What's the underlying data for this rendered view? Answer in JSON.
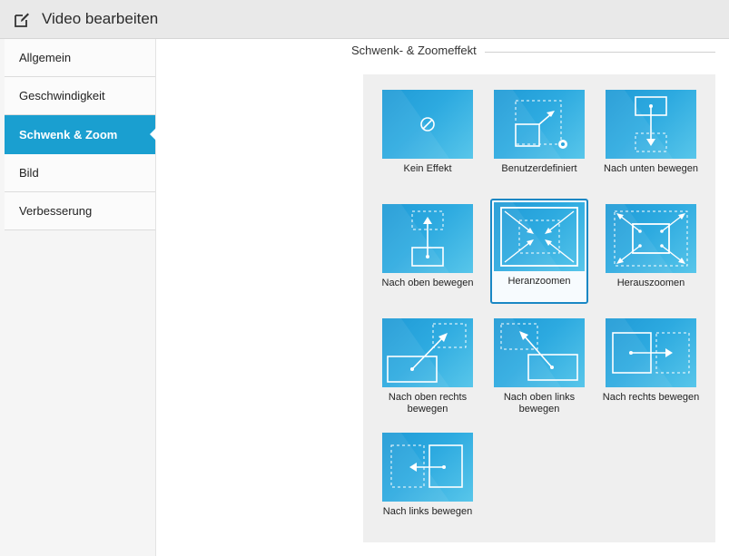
{
  "window": {
    "title": "Video bearbeiten",
    "icon": "edit-icon"
  },
  "sidebar": {
    "items": [
      {
        "label": "Allgemein",
        "active": false
      },
      {
        "label": "Geschwindigkeit",
        "active": false
      },
      {
        "label": "Schwenk & Zoom",
        "active": true
      },
      {
        "label": "Bild",
        "active": false
      },
      {
        "label": "Verbesserung",
        "active": false
      }
    ]
  },
  "section": {
    "title": "Schwenk- & Zoomeffekt"
  },
  "effects": [
    {
      "label": "Kein Effekt",
      "icon": "no-effect-icon",
      "selected": false
    },
    {
      "label": "Benutzerdefiniert",
      "icon": "custom-effect-icon",
      "selected": false
    },
    {
      "label": "Nach unten bewegen",
      "icon": "move-down-icon",
      "selected": false
    },
    {
      "label": "Nach oben bewegen",
      "icon": "move-up-icon",
      "selected": false
    },
    {
      "label": "Heranzoomen",
      "icon": "zoom-in-icon",
      "selected": true
    },
    {
      "label": "Herauszoomen",
      "icon": "zoom-out-icon",
      "selected": false
    },
    {
      "label": "Nach oben rechts bewegen",
      "icon": "move-up-right-icon",
      "selected": false
    },
    {
      "label": "Nach oben links bewegen",
      "icon": "move-up-left-icon",
      "selected": false
    },
    {
      "label": "Nach rechts bewegen",
      "icon": "move-right-icon",
      "selected": false
    },
    {
      "label": "Nach links bewegen",
      "icon": "move-left-icon",
      "selected": false
    }
  ],
  "colors": {
    "accent": "#1a9fd0",
    "selected_border": "#1a87c4"
  }
}
